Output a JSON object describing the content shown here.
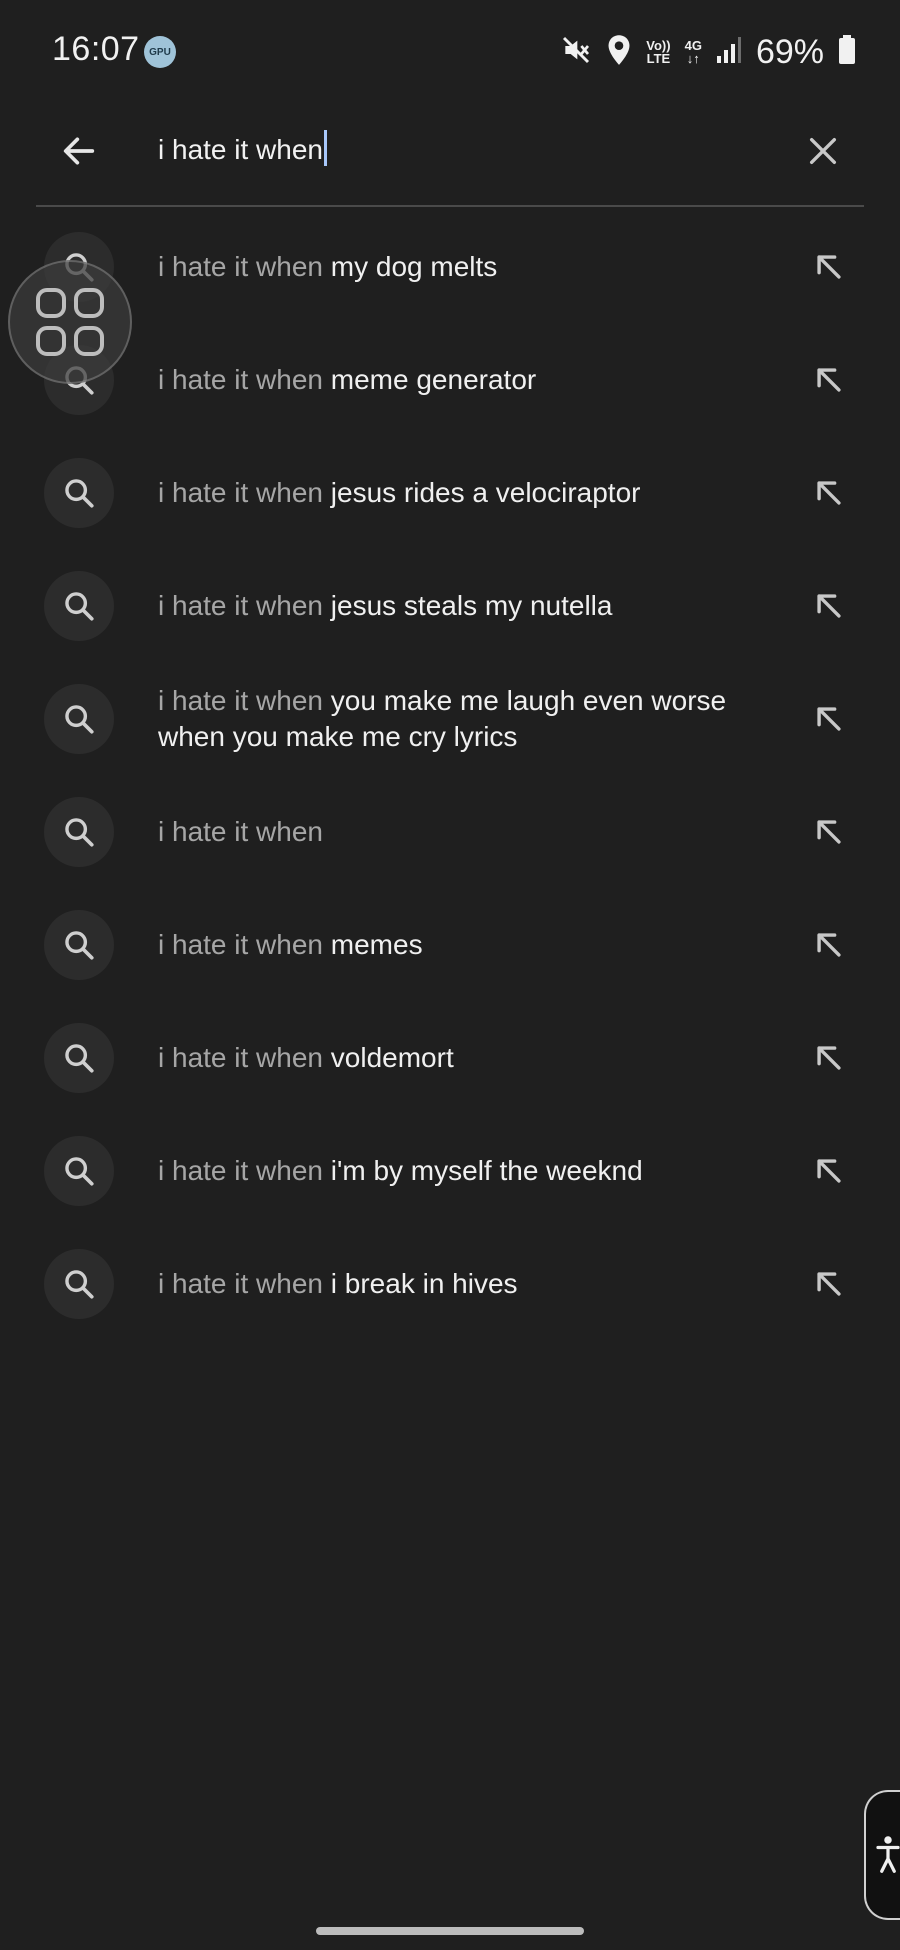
{
  "status_bar": {
    "time": "16:07",
    "gpu_badge": "GPU",
    "network_lte_top": "Vo))",
    "network_lte_bottom": "LTE",
    "network_type": "4G",
    "battery_percent": "69%",
    "icons": [
      "mute-icon",
      "location-icon",
      "signal-icon",
      "battery-icon"
    ]
  },
  "search": {
    "value": "i hate it when",
    "accent_color": "#a8c7fa"
  },
  "suggestions": [
    {
      "prefix": "i hate it when",
      "completion": " my dog melts"
    },
    {
      "prefix": "i hate it when",
      "completion": " meme generator"
    },
    {
      "prefix": "i hate it when",
      "completion": " jesus rides a velociraptor"
    },
    {
      "prefix": "i hate it when",
      "completion": " jesus steals my nutella"
    },
    {
      "prefix": "i hate it when",
      "completion": " you make me laugh even worse when you make me cry lyrics"
    },
    {
      "prefix": "i hate it when",
      "completion": ""
    },
    {
      "prefix": "i hate it when",
      "completion": " memes"
    },
    {
      "prefix": "i hate it when",
      "completion": " voldemort"
    },
    {
      "prefix": "i hate it when",
      "completion": " i'm by myself the weeknd"
    },
    {
      "prefix": "i hate it when",
      "completion": " i break in hives"
    }
  ],
  "colors": {
    "background": "#1f1f1f",
    "prefix_text": "#a6a6a6",
    "completion_text": "#f0f0f0",
    "icon_circle": "#2c2c2c"
  }
}
